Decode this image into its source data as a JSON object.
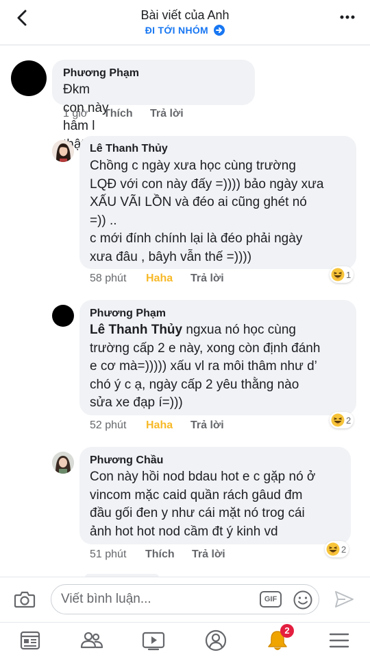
{
  "header": {
    "title": "Bài viết của Anh",
    "link_label": "ĐI TỚI NHÓM",
    "back_icon": "chevron-left-icon",
    "more_icon": "more-dots-icon"
  },
  "comments": [
    {
      "author": "Phương Phạm",
      "text": "Đkm con này hâm l thật=))))",
      "time": "1 giờ",
      "like_label": "Thích",
      "reply_label": "Trả lời"
    },
    {
      "author": "Lê Thanh Thủy",
      "lines": [
        "Chồng c ngày xưa học cùng trường",
        "LQĐ với con này đấy =)))) bảo ngày xưa",
        "XẤU VÃI LỒN và đéo ai cũng ghét nó",
        "=)) ..",
        "c mới đính chính lại là đéo phải ngày",
        "xưa đâu , bâyh vẫn thế =))))"
      ],
      "time": "58 phút",
      "reaction_label": "Haha",
      "reply_label": "Trả lời",
      "reaction_count": "1"
    },
    {
      "author": "Phương Phạm",
      "mention": "Lê Thanh Thủy",
      "first_line_rest": " ngxua nó học cùng",
      "lines": [
        "trường cấp 2 e này, xong còn định đánh",
        "e cơ mà=))))) xấu vl ra môi thâm như d’",
        "chó ý c ạ, ngày cấp 2 yêu thằng nào",
        "sửa xe đạp í=)))"
      ],
      "time": "52 phút",
      "reaction_label": "Haha",
      "reply_label": "Trả lời",
      "reaction_count": "2"
    },
    {
      "author": "Phương Chầu",
      "lines": [
        "Con này hồi nod bdau hot e c gặp nó ở",
        "vincom mặc caid quần rách gâud đm",
        "đầu gối đen y như cái mặt nó trog cái",
        "ảnh hot hot nod cầm đt ý kinh vd"
      ],
      "time": "51 phút",
      "like_label": "Thích",
      "reply_label": "Trả lời",
      "reaction_count": "2"
    }
  ],
  "composer": {
    "placeholder": "Viết bình luận...",
    "gif_label": "GIF",
    "camera_icon": "camera-icon",
    "emoji_icon": "emoji-icon",
    "send_icon": "send-icon"
  },
  "tabbar": {
    "notifications_badge": "2",
    "icons": [
      "feed-icon",
      "groups-icon",
      "watch-icon",
      "profile-icon",
      "notifications-bell-icon",
      "menu-icon"
    ]
  },
  "colors": {
    "accent": "#1877f2",
    "haha": "#f7b928",
    "bubble": "#f0f2f5",
    "badge": "#e41e3f"
  }
}
